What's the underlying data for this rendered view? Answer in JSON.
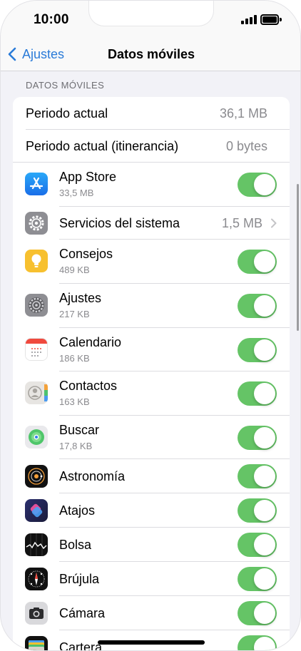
{
  "status_bar": {
    "time": "10:00"
  },
  "nav": {
    "back_label": "Ajustes",
    "title": "Datos móviles"
  },
  "section": {
    "header": "DATOS MÓVILES"
  },
  "stats": [
    {
      "label": "Periodo actual",
      "value": "36,1 MB"
    },
    {
      "label": "Periodo actual (itinerancia)",
      "value": "0 bytes"
    }
  ],
  "apps": [
    {
      "name": "App Store",
      "size": "33,5 MB",
      "icon": "app-store-icon",
      "toggle": "on"
    },
    {
      "name": "Servicios del sistema",
      "value": "1,5 MB",
      "icon": "system-services-gear-icon"
    },
    {
      "name": "Consejos",
      "size": "489 KB",
      "icon": "tips-lightbulb-icon",
      "toggle": "on"
    },
    {
      "name": "Ajustes",
      "size": "217 KB",
      "icon": "settings-gear-icon",
      "toggle": "on"
    },
    {
      "name": "Calendario",
      "size": "186 KB",
      "icon": "calendar-icon",
      "toggle": "on"
    },
    {
      "name": "Contactos",
      "size": "163 KB",
      "icon": "contacts-icon",
      "toggle": "on"
    },
    {
      "name": "Buscar",
      "size": "17,8 KB",
      "icon": "find-my-icon",
      "toggle": "on"
    },
    {
      "name": "Astronomía",
      "icon": "astronomy-icon",
      "toggle": "on"
    },
    {
      "name": "Atajos",
      "icon": "shortcuts-icon",
      "toggle": "on"
    },
    {
      "name": "Bolsa",
      "icon": "stocks-icon",
      "toggle": "on"
    },
    {
      "name": "Brújula",
      "icon": "compass-icon",
      "toggle": "on"
    },
    {
      "name": "Cámara",
      "icon": "camera-icon",
      "toggle": "on"
    },
    {
      "name": "Cartera",
      "icon": "wallet-icon",
      "toggle": "on"
    }
  ],
  "colors": {
    "accent": "#2a7bd8",
    "toggle_on": "#65c466",
    "background": "#f2f2f7"
  }
}
